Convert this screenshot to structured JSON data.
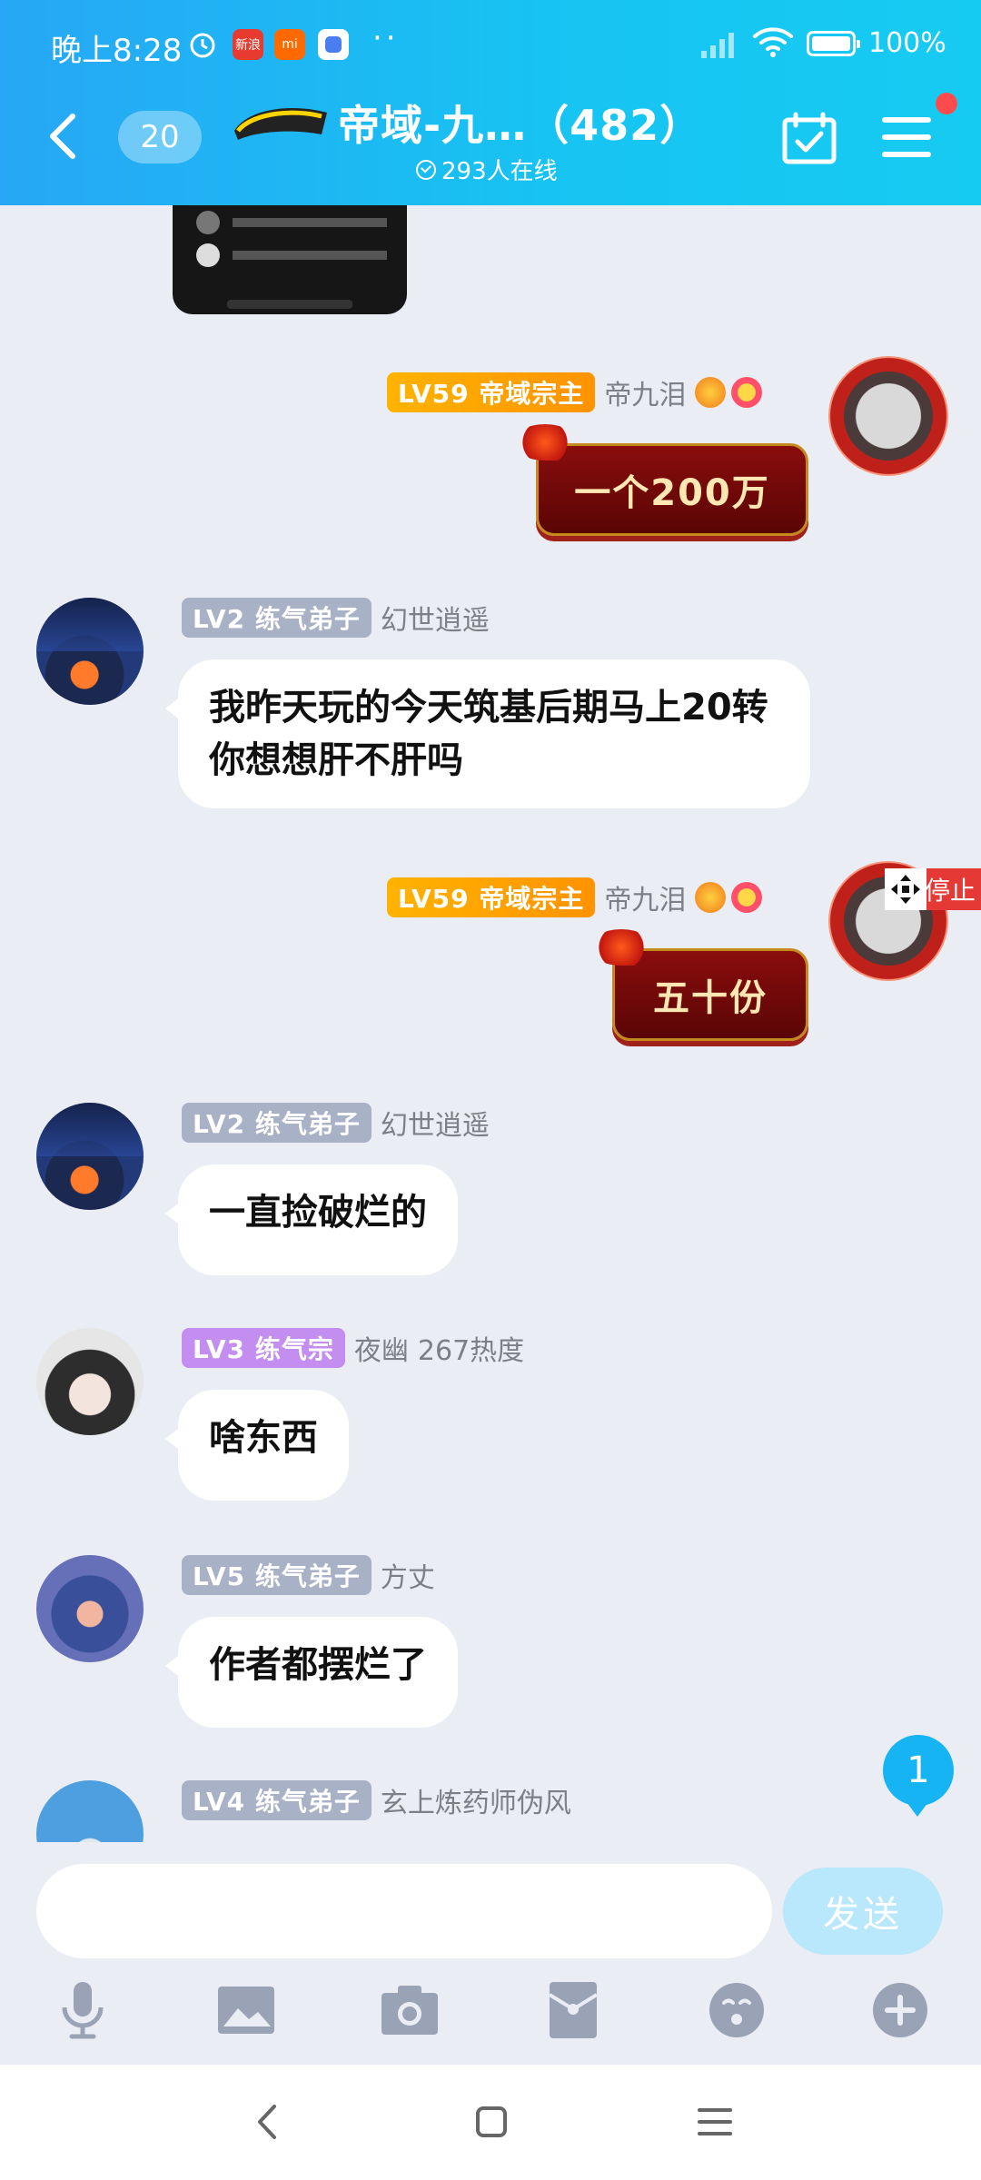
{
  "status_bar": {
    "time": "晚上8:28",
    "app_icons": [
      "alarm-icon",
      "sina-news-icon",
      "mi-icon",
      "app-icon"
    ],
    "more": "··",
    "battery": "100"
  },
  "header": {
    "unread_count": "20",
    "title": "帝域-九…（482）",
    "online": "293人在线"
  },
  "messages": [
    {
      "side": "right",
      "level": "LV59 帝域宗主",
      "name": "帝九泪",
      "text": "一个200万"
    },
    {
      "side": "left",
      "level": "LV2 练气弟子",
      "name": "幻世逍遥",
      "text": "我昨天玩的今天筑基后期马上20转你想想肝不肝吗"
    },
    {
      "side": "right",
      "level": "LV59 帝域宗主",
      "name": "帝九泪",
      "text": "五十份"
    },
    {
      "side": "left",
      "level": "LV2 练气弟子",
      "name": "幻世逍遥",
      "text": "一直捡破烂的"
    },
    {
      "side": "left",
      "level": "LV3 练气宗",
      "name": "夜幽",
      "extra": "267热度",
      "text": "啥东西"
    },
    {
      "side": "left",
      "level": "LV5 练气弟子",
      "name": "方丈",
      "text": "作者都摆烂了"
    },
    {
      "side": "left",
      "level": "LV4 练气弟子",
      "name": "玄上炼药师伪风",
      "text": ""
    }
  ],
  "stop_label": "停止",
  "new_message_badge": "1",
  "composer": {
    "placeholder": "",
    "send_label": "发送",
    "tools": [
      "microphone-icon",
      "image-icon",
      "camera-icon",
      "red-packet-icon",
      "emoji-icon",
      "plus-icon"
    ]
  },
  "system_nav": [
    "back-icon",
    "home-icon",
    "recents-icon"
  ],
  "colors": {
    "header_start": "#27a7f5",
    "header_end": "#16cbf2",
    "chat_background": "#ebedf5",
    "level_gray": "#a9b1c6",
    "level_purple": "#c48ef0",
    "level_gold": "#ffa800",
    "red_bubble": "#7a0a0a",
    "send_button": "#b9e7fb"
  }
}
